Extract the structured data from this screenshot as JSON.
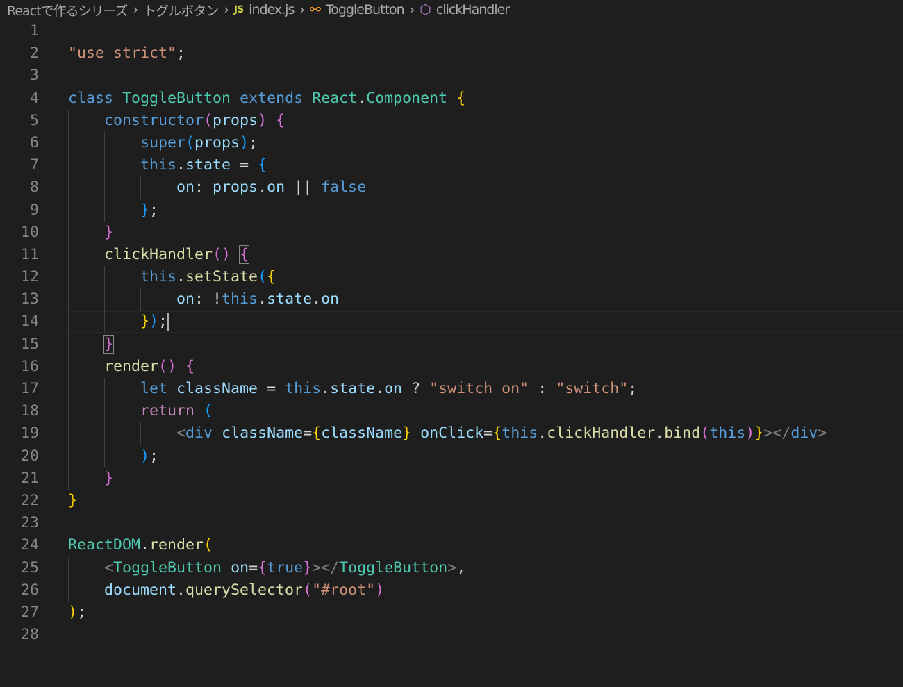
{
  "breadcrumb": {
    "folder": "Reactで作るシリーズ",
    "subfolder": "トグルボタン",
    "file_icon": "JS",
    "file": "index.js",
    "class": "ToggleButton",
    "method": "clickHandler"
  },
  "editor": {
    "current_line": 14,
    "lines": [
      [],
      [
        [
          "\"use strict\"",
          "s"
        ],
        [
          ";",
          "p"
        ]
      ],
      [],
      [
        [
          "class",
          "k"
        ],
        [
          " ",
          "p"
        ],
        [
          "ToggleButton",
          "c"
        ],
        [
          " ",
          "p"
        ],
        [
          "extends",
          "k"
        ],
        [
          " ",
          "p"
        ],
        [
          "React",
          "c"
        ],
        [
          ".",
          "p"
        ],
        [
          "Component",
          "c"
        ],
        [
          " ",
          "p"
        ],
        [
          "{",
          "b1"
        ]
      ],
      [
        [
          "    ",
          "p"
        ],
        [
          "constructor",
          "k"
        ],
        [
          "(",
          "b2"
        ],
        [
          "props",
          "v"
        ],
        [
          ")",
          "b2"
        ],
        [
          " ",
          "p"
        ],
        [
          "{",
          "b2"
        ]
      ],
      [
        [
          "        ",
          "p"
        ],
        [
          "super",
          "k"
        ],
        [
          "(",
          "b3"
        ],
        [
          "props",
          "v"
        ],
        [
          ")",
          "b3"
        ],
        [
          ";",
          "p"
        ]
      ],
      [
        [
          "        ",
          "p"
        ],
        [
          "this",
          "k"
        ],
        [
          ".",
          "p"
        ],
        [
          "state",
          "v"
        ],
        [
          " = ",
          "p"
        ],
        [
          "{",
          "b3"
        ]
      ],
      [
        [
          "            ",
          "p"
        ],
        [
          "on",
          "v"
        ],
        [
          ": ",
          "p"
        ],
        [
          "props",
          "v"
        ],
        [
          ".",
          "p"
        ],
        [
          "on",
          "v"
        ],
        [
          " || ",
          "p"
        ],
        [
          "false",
          "k"
        ]
      ],
      [
        [
          "        ",
          "p"
        ],
        [
          "}",
          "b3"
        ],
        [
          ";",
          "p"
        ]
      ],
      [
        [
          "    ",
          "p"
        ],
        [
          "}",
          "b2"
        ]
      ],
      [
        [
          "    ",
          "p"
        ],
        [
          "clickHandler",
          "f"
        ],
        [
          "()",
          "b2"
        ],
        [
          " ",
          "p"
        ],
        [
          "{",
          "b2 match"
        ]
      ],
      [
        [
          "        ",
          "p"
        ],
        [
          "this",
          "k"
        ],
        [
          ".",
          "p"
        ],
        [
          "setState",
          "f"
        ],
        [
          "(",
          "b3"
        ],
        [
          "{",
          "b1"
        ]
      ],
      [
        [
          "            ",
          "p"
        ],
        [
          "on",
          "v"
        ],
        [
          ": !",
          "p"
        ],
        [
          "this",
          "k"
        ],
        [
          ".",
          "p"
        ],
        [
          "state",
          "v"
        ],
        [
          ".",
          "p"
        ],
        [
          "on",
          "v"
        ]
      ],
      [
        [
          "        ",
          "p"
        ],
        [
          "}",
          "b1"
        ],
        [
          ")",
          "b3"
        ],
        [
          ";",
          "p"
        ]
      ],
      [
        [
          "    ",
          "p"
        ],
        [
          "}",
          "b2 match"
        ]
      ],
      [
        [
          "    ",
          "p"
        ],
        [
          "render",
          "f"
        ],
        [
          "()",
          "b2"
        ],
        [
          " ",
          "p"
        ],
        [
          "{",
          "b2"
        ]
      ],
      [
        [
          "        ",
          "p"
        ],
        [
          "let",
          "k"
        ],
        [
          " ",
          "p"
        ],
        [
          "className",
          "v"
        ],
        [
          " = ",
          "p"
        ],
        [
          "this",
          "k"
        ],
        [
          ".",
          "p"
        ],
        [
          "state",
          "v"
        ],
        [
          ".",
          "p"
        ],
        [
          "on",
          "v"
        ],
        [
          " ? ",
          "p"
        ],
        [
          "\"switch on\"",
          "s"
        ],
        [
          " : ",
          "p"
        ],
        [
          "\"switch\"",
          "s"
        ],
        [
          ";",
          "p"
        ]
      ],
      [
        [
          "        ",
          "p"
        ],
        [
          "return",
          "r"
        ],
        [
          " ",
          "p"
        ],
        [
          "(",
          "b3"
        ]
      ],
      [
        [
          "            ",
          "p"
        ],
        [
          "<",
          "g"
        ],
        [
          "div",
          "k"
        ],
        [
          " ",
          "p"
        ],
        [
          "className",
          "v"
        ],
        [
          "=",
          "p"
        ],
        [
          "{",
          "b1"
        ],
        [
          "className",
          "v"
        ],
        [
          "}",
          "b1"
        ],
        [
          " ",
          "p"
        ],
        [
          "onClick",
          "v"
        ],
        [
          "=",
          "p"
        ],
        [
          "{",
          "b1"
        ],
        [
          "this",
          "k"
        ],
        [
          ".",
          "p"
        ],
        [
          "clickHandler",
          "f"
        ],
        [
          ".",
          "p"
        ],
        [
          "bind",
          "f"
        ],
        [
          "(",
          "b2"
        ],
        [
          "this",
          "k"
        ],
        [
          ")",
          "b2"
        ],
        [
          "}",
          "b1"
        ],
        [
          "></",
          "g"
        ],
        [
          "div",
          "k"
        ],
        [
          ">",
          "g"
        ]
      ],
      [
        [
          "        ",
          "p"
        ],
        [
          ")",
          "b3"
        ],
        [
          ";",
          "p"
        ]
      ],
      [
        [
          "    ",
          "p"
        ],
        [
          "}",
          "b2"
        ]
      ],
      [
        [
          "}",
          "b1"
        ]
      ],
      [],
      [
        [
          "ReactDOM",
          "c"
        ],
        [
          ".",
          "p"
        ],
        [
          "render",
          "f"
        ],
        [
          "(",
          "b1"
        ]
      ],
      [
        [
          "    ",
          "p"
        ],
        [
          "<",
          "g"
        ],
        [
          "ToggleButton",
          "c"
        ],
        [
          " ",
          "p"
        ],
        [
          "on",
          "v"
        ],
        [
          "=",
          "p"
        ],
        [
          "{",
          "b2"
        ],
        [
          "true",
          "k"
        ],
        [
          "}",
          "b2"
        ],
        [
          "></",
          "g"
        ],
        [
          "ToggleButton",
          "c"
        ],
        [
          ">",
          "g"
        ],
        [
          ",",
          "p"
        ]
      ],
      [
        [
          "    ",
          "p"
        ],
        [
          "document",
          "v"
        ],
        [
          ".",
          "p"
        ],
        [
          "querySelector",
          "f"
        ],
        [
          "(",
          "b2"
        ],
        [
          "\"#root\"",
          "s"
        ],
        [
          ")",
          "b2"
        ]
      ],
      [
        [
          ")",
          "b1"
        ],
        [
          ";",
          "p"
        ]
      ],
      []
    ]
  }
}
